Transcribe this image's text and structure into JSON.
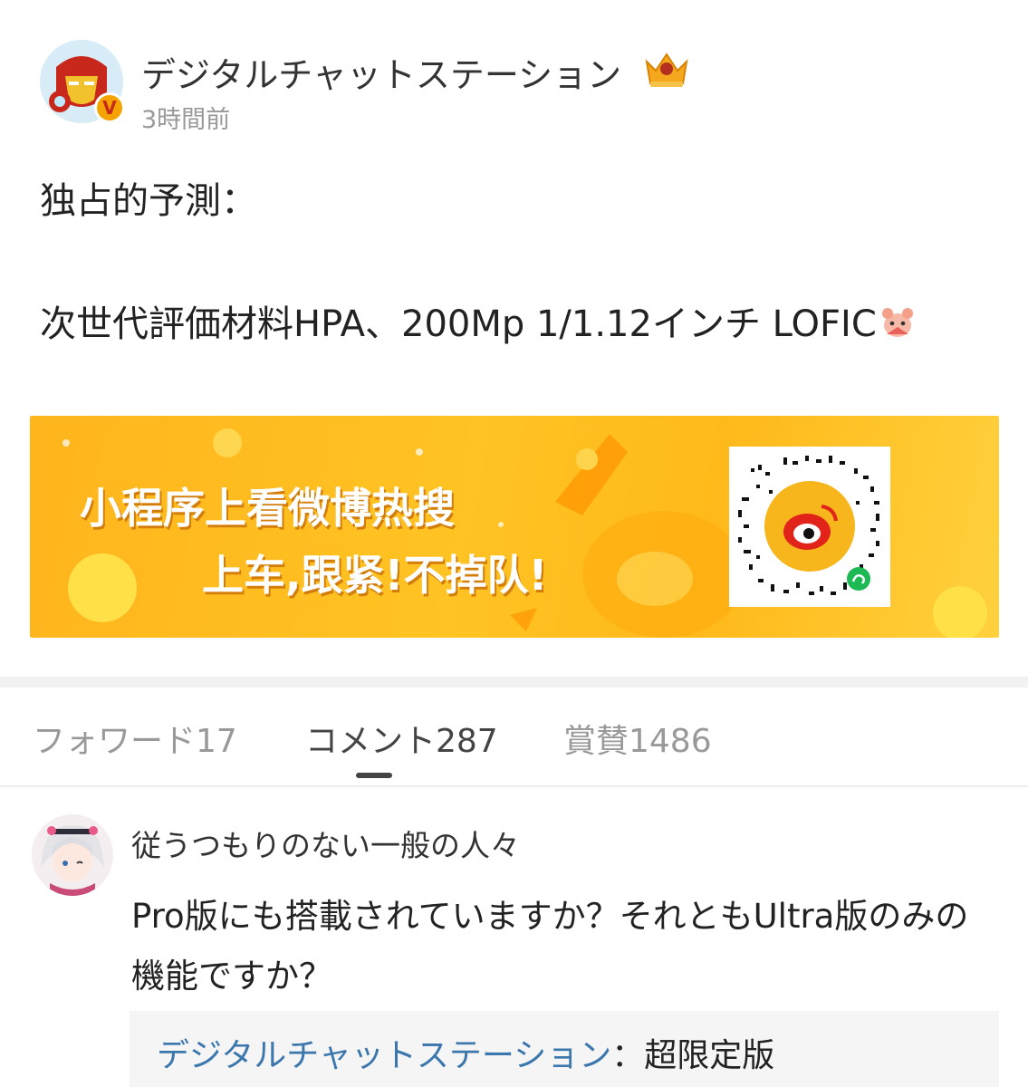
{
  "post": {
    "author": "デジタルチャットステーション",
    "timestamp": "3時間前",
    "verified_mark": "V",
    "line1": "独占的予測：",
    "line2": "次世代評価材料HPA、200Mp 1/1.12インチ LOFIC"
  },
  "banner": {
    "line1": "小程序上看微博热搜",
    "line2": "上车,跟紧!不掉队!"
  },
  "tabs": {
    "forward": "フォワード17",
    "comment": "コメント287",
    "like": "賞賛1486",
    "active": "comment"
  },
  "comment": {
    "user": "従うつもりのない一般の人々",
    "text": "Pro版にも搭載されていますか？それともUltra版のみの機能ですか？",
    "reply": {
      "author": "デジタルチャットステーション",
      "separator": "：",
      "text": "超限定版"
    }
  },
  "colors": {
    "link": "#3b77ad",
    "banner": "#ffbc1f",
    "muted": "#999999"
  },
  "icons": {
    "crown": "crown-level-badge-icon",
    "verified": "verified-v-icon",
    "emoji": "doge-fan-emoji-icon",
    "qr": "mini-program-qr-code"
  }
}
